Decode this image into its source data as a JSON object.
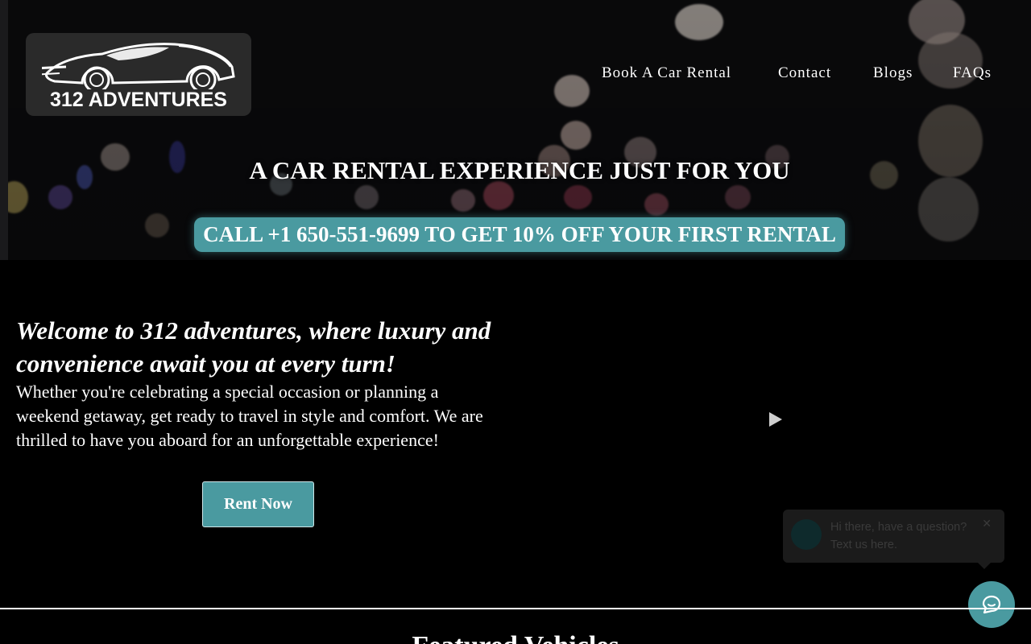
{
  "header": {
    "logo_text": "312 ADVENTURES",
    "nav": [
      {
        "label": "Book A Car Rental"
      },
      {
        "label": "Contact"
      },
      {
        "label": "Blogs"
      },
      {
        "label": "FAQs"
      }
    ]
  },
  "hero": {
    "title": "A CAR RENTAL EXPERIENCE JUST FOR YOU",
    "promo": "CALL +1 650-551-9699 TO GET 10% OFF YOUR FIRST RENTAL"
  },
  "welcome": {
    "heading": "Welcome to 312 adventures, where luxury and convenience await you at every turn!",
    "body": "Whether you're celebrating a special occasion or planning a weekend getaway, get ready to travel in style and comfort. We are thrilled to have you aboard for an unforgettable experience!",
    "cta_label": "Rent Now"
  },
  "video": {
    "play_icon": "play-icon"
  },
  "chat": {
    "message": "Hi there, have a question? Text us here.",
    "close_glyph": "✕",
    "launcher_icon": "chat-icon"
  },
  "featured": {
    "title": "Featured Vehicles"
  },
  "colors": {
    "accent": "#4a9aa0",
    "background": "#000000"
  }
}
